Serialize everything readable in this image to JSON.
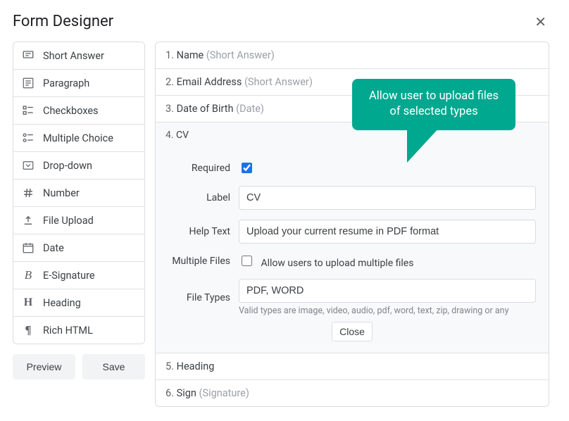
{
  "title": "Form Designer",
  "fieldTypes": [
    {
      "icon": "short-answer",
      "label": "Short Answer"
    },
    {
      "icon": "paragraph",
      "label": "Paragraph"
    },
    {
      "icon": "checkboxes",
      "label": "Checkboxes"
    },
    {
      "icon": "multiple",
      "label": "Multiple Choice"
    },
    {
      "icon": "dropdown",
      "label": "Drop-down"
    },
    {
      "icon": "number",
      "label": "Number"
    },
    {
      "icon": "upload",
      "label": "File Upload"
    },
    {
      "icon": "date",
      "label": "Date"
    },
    {
      "icon": "signature",
      "label": "E-Signature"
    },
    {
      "icon": "heading",
      "label": "Heading"
    },
    {
      "icon": "richhtml",
      "label": "Rich HTML"
    }
  ],
  "actions": {
    "preview": "Preview",
    "save": "Save"
  },
  "items": {
    "i1": {
      "num": "1.",
      "name": "Name",
      "type": "(Short Answer)"
    },
    "i2": {
      "num": "2.",
      "name": "Email Address",
      "type": "(Short Answer)"
    },
    "i3": {
      "num": "3.",
      "name": "Date of Birth",
      "type": "(Date)"
    },
    "i4": {
      "num": "4.",
      "name": "CV"
    },
    "i5": {
      "num": "5.",
      "name": "Heading",
      "type": ""
    },
    "i6": {
      "num": "6.",
      "name": "Sign",
      "type": "(Signature)"
    }
  },
  "editor": {
    "labels": {
      "required": "Required",
      "label": "Label",
      "helpText": "Help Text",
      "multiple": "Multiple Files",
      "multipleInline": "Allow users to upload multiple files",
      "fileTypes": "File Types"
    },
    "values": {
      "required": true,
      "label": "CV",
      "helpText": "Upload your current resume in PDF format",
      "multiple": false,
      "fileTypes": "PDF, WORD"
    },
    "hint": "Valid types are image, video, audio, pdf, word, text, zip, drawing or any",
    "closeText": "Close"
  },
  "callout": "Allow user to upload files of selected types"
}
